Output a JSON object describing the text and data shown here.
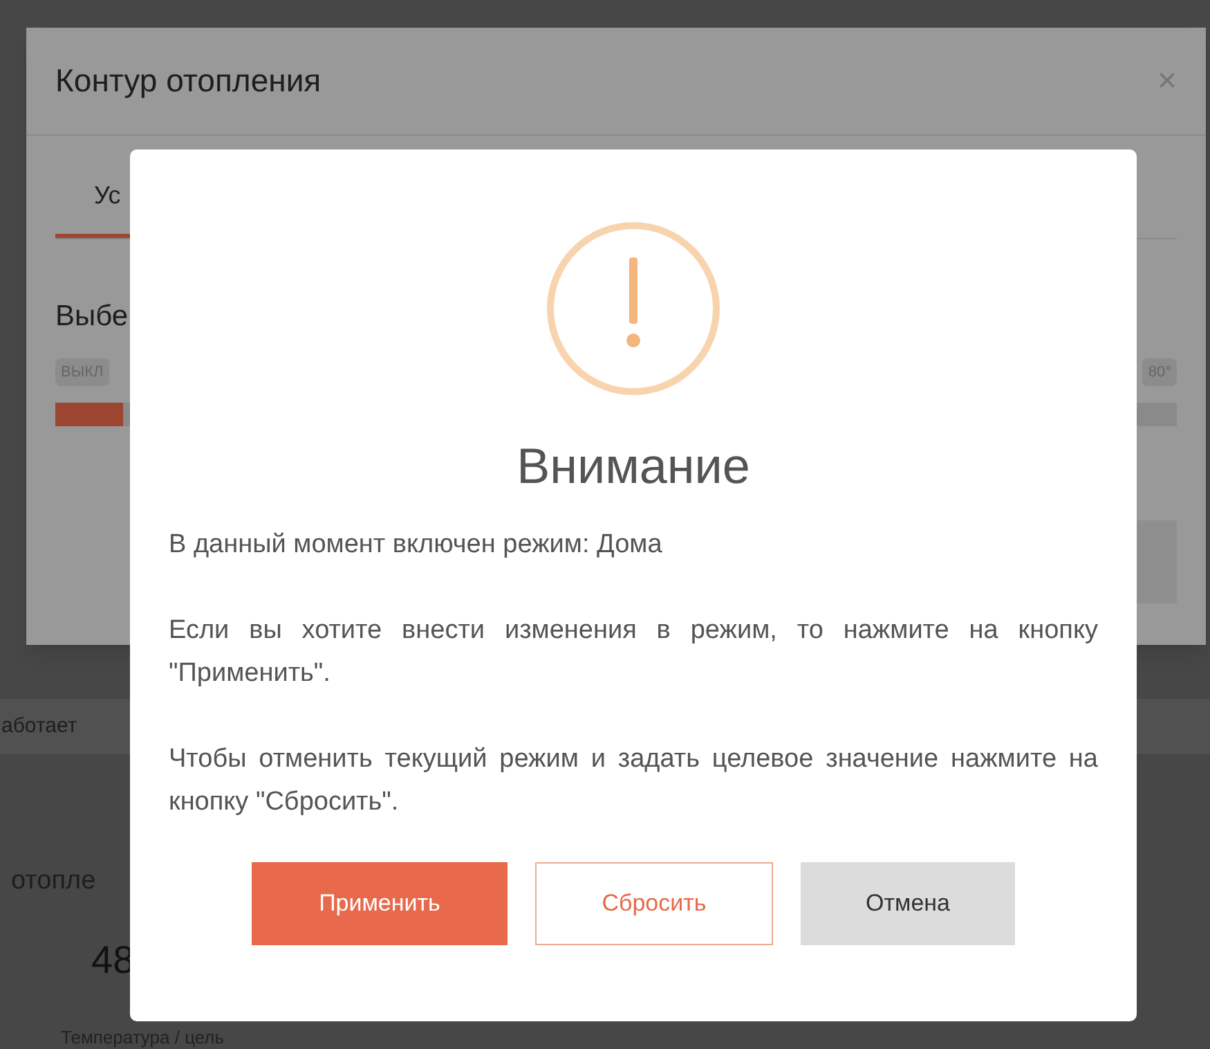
{
  "back_dialog": {
    "title": "Контур отопления",
    "close": "×",
    "tabs": [
      {
        "label": "Ус",
        "selected": true
      }
    ],
    "section_label": "Выбе",
    "slider": {
      "min_label": "ВЫКЛ",
      "max_label": "80°",
      "level": 0.06
    }
  },
  "background_page": {
    "status": "аботает",
    "section": "отопле",
    "value": "48",
    "caption": "Температура / цель"
  },
  "alert": {
    "title": "Внимание",
    "paragraphs": [
      "В данный момент включен режим: Дома",
      "Если вы хотите внести изменения в режим, то нажмите на кнопку \"Применить\".",
      "Чтобы отменить текущий режим и задать целевое значение нажмите на кнопку \"Сбросить\"."
    ],
    "buttons": [
      {
        "label": "Применить",
        "kind": "primary"
      },
      {
        "label": "Сбросить",
        "kind": "outline"
      },
      {
        "label": "Отмена",
        "kind": "neutral"
      }
    ]
  }
}
